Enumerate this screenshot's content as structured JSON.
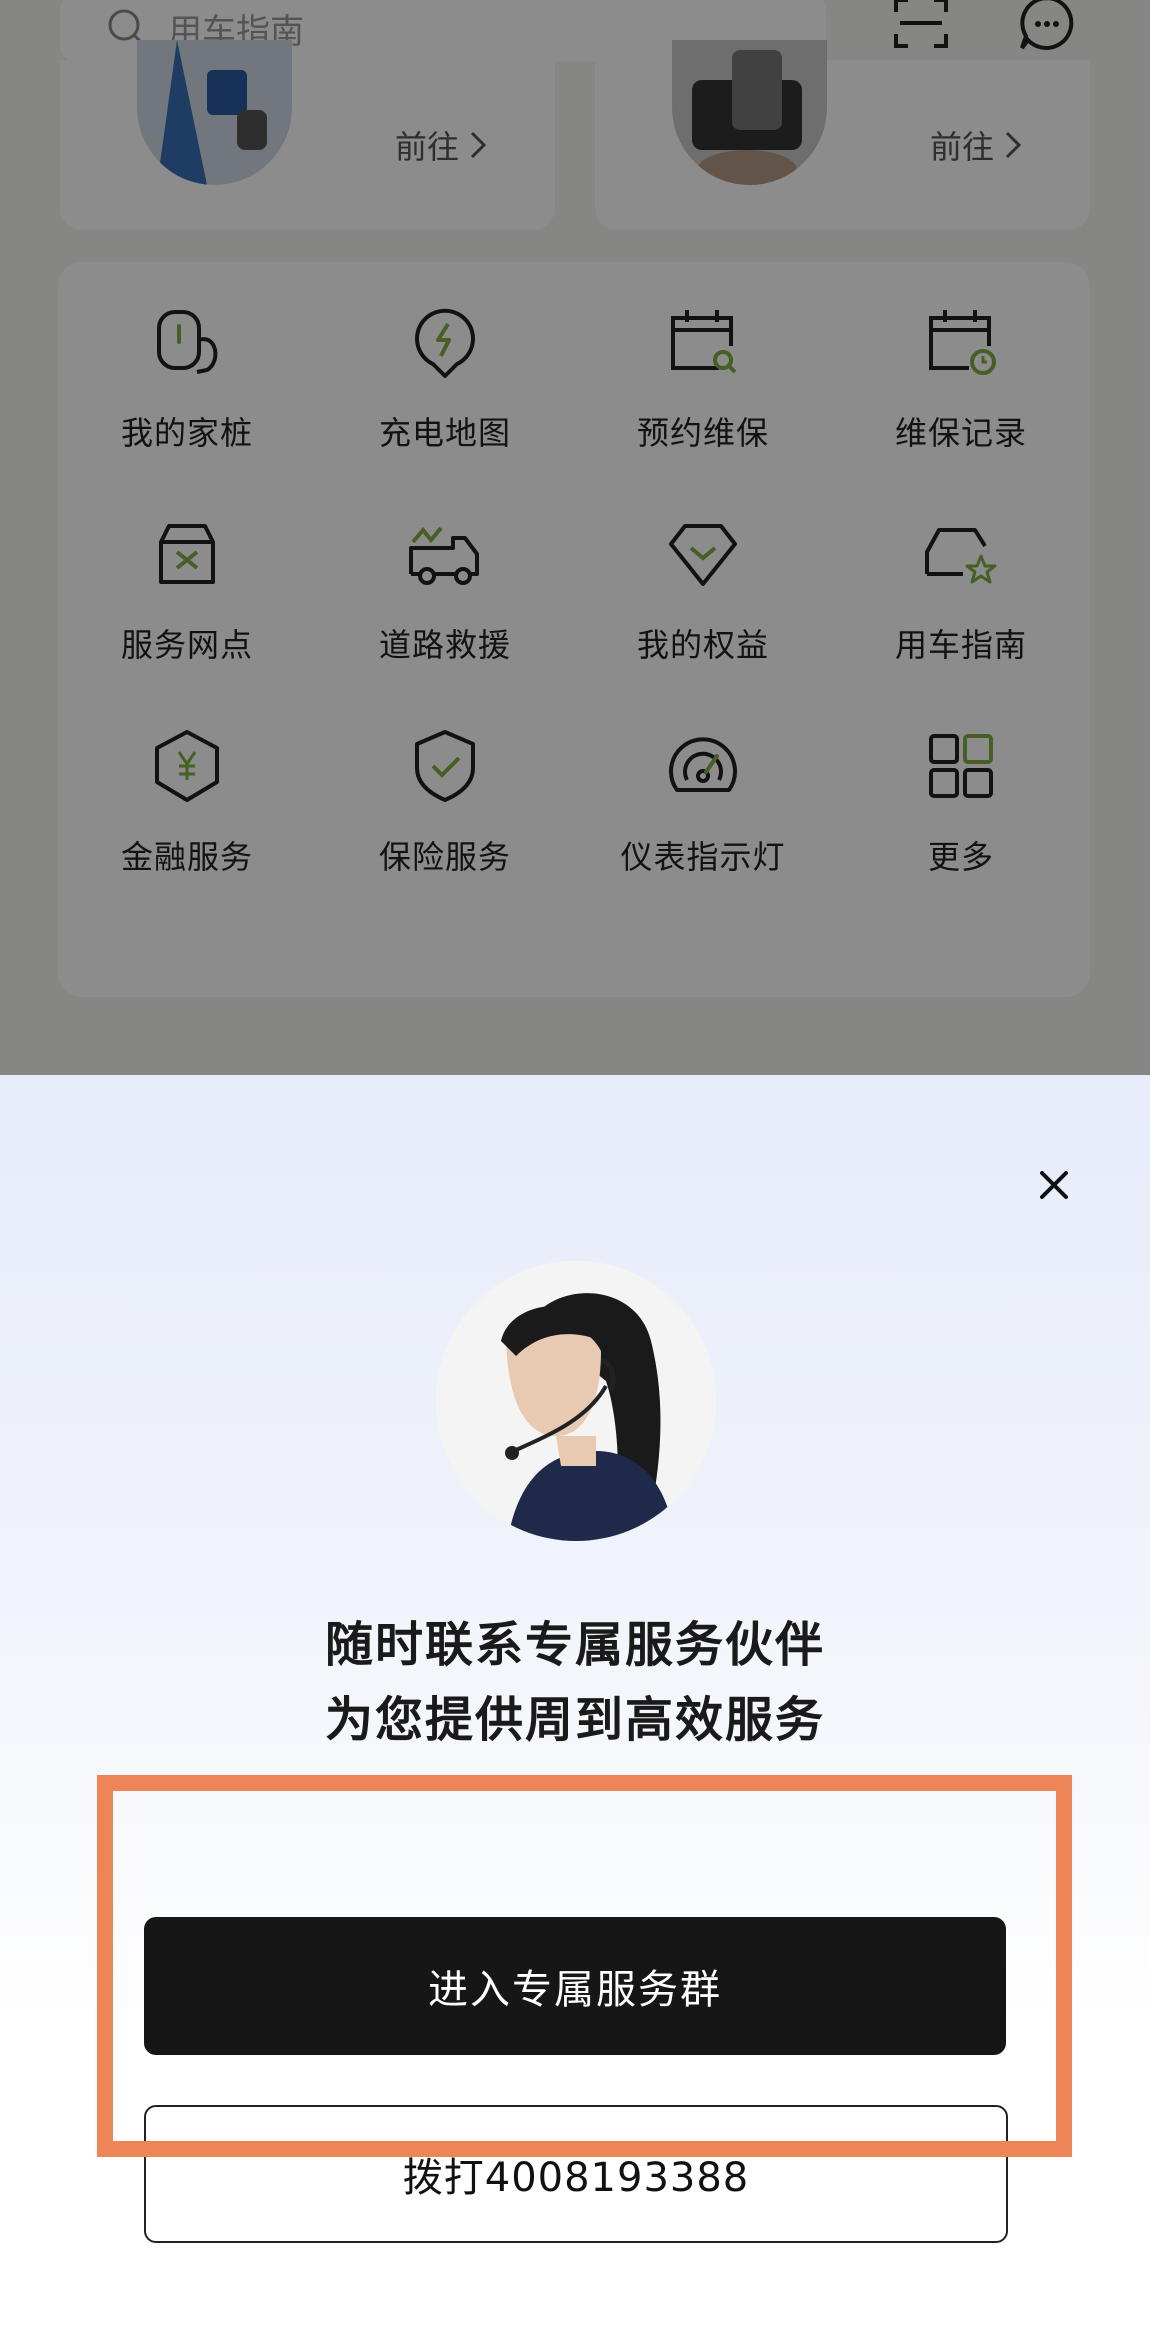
{
  "search": {
    "placeholder": "用车指南"
  },
  "header_icons": [
    "scan-icon",
    "message-icon"
  ],
  "cards": [
    {
      "cta": "前往"
    },
    {
      "cta": "前往"
    }
  ],
  "services": [
    {
      "label": "我的家桩",
      "icon": "home-charger-icon"
    },
    {
      "label": "充电地图",
      "icon": "charging-map-icon"
    },
    {
      "label": "预约维保",
      "icon": "book-maintenance-icon"
    },
    {
      "label": "维保记录",
      "icon": "maintenance-record-icon"
    },
    {
      "label": "服务网点",
      "icon": "service-outlet-icon"
    },
    {
      "label": "道路救援",
      "icon": "road-rescue-icon"
    },
    {
      "label": "我的权益",
      "icon": "my-benefits-icon"
    },
    {
      "label": "用车指南",
      "icon": "car-guide-icon"
    },
    {
      "label": "金融服务",
      "icon": "finance-icon"
    },
    {
      "label": "保险服务",
      "icon": "insurance-icon"
    },
    {
      "label": "仪表指示灯",
      "icon": "dashboard-lights-icon"
    },
    {
      "label": "更多",
      "icon": "more-grid-icon"
    }
  ],
  "sheet": {
    "headline_line1": "随时联系专属服务伙伴",
    "headline_line2": "为您提供周到高效服务",
    "primary_button": "进入专属服务群",
    "secondary_button": "拨打4008193388"
  },
  "colors": {
    "accent_green": "#7fae42",
    "highlight": "#ee8557",
    "primary_button_bg": "#161616"
  }
}
